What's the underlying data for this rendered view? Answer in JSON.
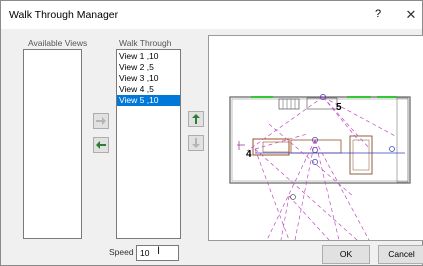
{
  "window": {
    "title": "Walk Through Manager",
    "help": "?",
    "close": "✕"
  },
  "available_views": {
    "label": "Available Views",
    "items": []
  },
  "walk_through": {
    "label": "Walk Through",
    "items": [
      "View 1 ,10",
      "View 2 ,5",
      "View 3 ,10",
      "View 4 ,5",
      "View 5 ,10"
    ],
    "selected_index": 4
  },
  "speed": {
    "label": "Speed",
    "value": "10"
  },
  "preview": {
    "labels": [
      "5",
      "4"
    ]
  },
  "buttons": {
    "ok": "OK",
    "cancel": "Cancel"
  },
  "icons": {
    "add": "arrow-right-icon",
    "remove": "arrow-left-icon",
    "up": "arrow-up-icon",
    "down": "arrow-down-icon"
  },
  "colors": {
    "selection": "#0078d7",
    "arrow_active": "#2e7d32",
    "camera_lines": "#c04cc0"
  }
}
